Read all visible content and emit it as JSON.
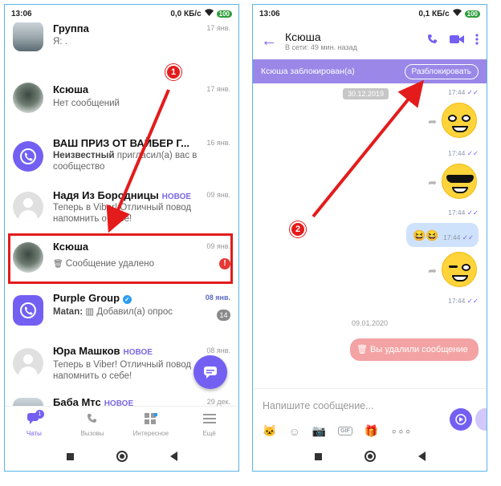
{
  "left": {
    "status": {
      "time": "13:06",
      "speed": "0,0 КБ/с",
      "battery": "100"
    },
    "chats": [
      {
        "name": "Группа",
        "new": "",
        "date": "17 янв.",
        "msg_prefix": "",
        "msg": "Я: .",
        "date_style": "grey"
      },
      {
        "name": "Ксюша",
        "new": "",
        "date": "17 янв.",
        "msg_prefix": "",
        "msg": "Нет сообщений",
        "date_style": "grey"
      },
      {
        "name": "ВАШ ПРИЗ ОТ ВАЙБЕР Г...",
        "new": "",
        "date": "16 янв.",
        "msg_prefix": "Неизвестный ",
        "msg": "пригласил(а) вас в сообщество",
        "date_style": "grey"
      },
      {
        "name": "Надя Из Бородницы",
        "new": "НОВОЕ",
        "date": "09 янв.",
        "msg_prefix": "",
        "msg": "Теперь в Viber! Отличный повод напомнить о себе!",
        "date_style": "grey"
      },
      {
        "name": "Ксюша",
        "new": "",
        "date": "09 янв.",
        "msg_prefix": "",
        "msg": "Сообщение удалено",
        "date_style": "grey"
      },
      {
        "name": "Purple Group",
        "new": "",
        "date": "08 янв.",
        "msg_prefix": "Matan: ",
        "msg": "Добавил(а) опрос",
        "date_style": "blue"
      },
      {
        "name": "Юра Машков",
        "new": "НОВОЕ",
        "date": "08 янв.",
        "msg_prefix": "",
        "msg": "Теперь в Viber! Отличный повод напомнить о себе!",
        "date_style": "grey"
      },
      {
        "name": "Баба Мтс",
        "new": "НОВОЕ",
        "date": "29 дек.",
        "msg_prefix": "",
        "msg": "",
        "date_style": "grey"
      }
    ],
    "badges": {
      "deleted_alert": "!",
      "purple_count": "14",
      "chats_tab_count": "1"
    },
    "tabs": [
      "Чаты",
      "Вызовы",
      "Интересное",
      "Ещё"
    ]
  },
  "right": {
    "status": {
      "time": "13:06",
      "speed": "0,1 КБ/с",
      "battery": "100"
    },
    "header": {
      "name": "Ксюша",
      "status": "В сети: 49 мин. назад"
    },
    "blocked": {
      "text": "Ксюша заблокирован(а)",
      "button": "Разблокировать"
    },
    "messages": {
      "date_chip": "30.12.2019",
      "times": [
        "17:44",
        "17:44",
        "17:44",
        "17:44",
        "17:44"
      ],
      "date2": "09.01.2020",
      "deleted": "Вы удалили сообщение"
    },
    "input": {
      "placeholder": "Напишите сообщение..."
    },
    "tools": [
      "cat-sticker-icon",
      "emoji-icon",
      "camera-icon",
      "gif-icon",
      "gift-icon",
      "more-icon"
    ]
  },
  "steps": [
    "1",
    "2"
  ],
  "colors": {
    "viber_purple": "#7360f2",
    "highlight_red": "#e21b1b",
    "blocked_bar": "#9a87e8",
    "deleted_bubble": "#f3a3a3"
  }
}
